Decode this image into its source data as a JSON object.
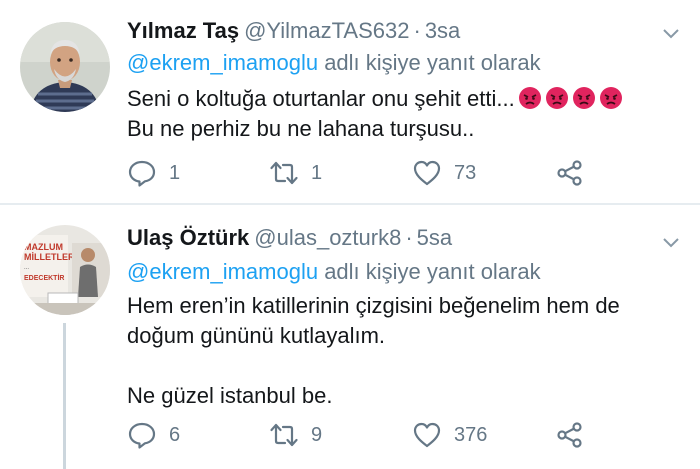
{
  "tweets": [
    {
      "name": "Yılmaz Taş",
      "handle": "@YilmazTAS632",
      "separator": "·",
      "time": "3sa",
      "reply_mention": "@ekrem_imamoglu",
      "reply_suffix": "adlı kişiye yanıt olarak",
      "text_lines": [
        "Seni o koltuğa oturtanlar onu şehit etti...",
        "Bu ne perhiz bu ne lahana turşusu.."
      ],
      "emojis": [
        "pouting-face-icon",
        "pouting-face-icon",
        "pouting-face-icon",
        "pouting-face-icon"
      ],
      "replies": "1",
      "retweets": "1",
      "likes": "73"
    },
    {
      "name": "Ulaş Öztürk",
      "handle": "@ulas_ozturk8",
      "separator": "·",
      "time": "5sa",
      "reply_mention": "@ekrem_imamoglu",
      "reply_suffix": "adlı kişiye yanıt olarak",
      "text_lines": [
        "Hem eren’in katillerinin çizgisini beğenelim hem de",
        "doğum gününü kutlayalım.",
        "",
        "Ne güzel istanbul be."
      ],
      "avatar_sign_text": [
        "MAZLUM",
        "MİLLETLER",
        "...",
        "EDECEKTİR"
      ],
      "replies": "6",
      "retweets": "9",
      "likes": "376"
    }
  ],
  "colors": {
    "accent": "#1da1f2",
    "secondary_text": "#657786",
    "primary_text": "#14171a",
    "divider": "#e6ecf0",
    "emoji_red": "#e0245e"
  }
}
